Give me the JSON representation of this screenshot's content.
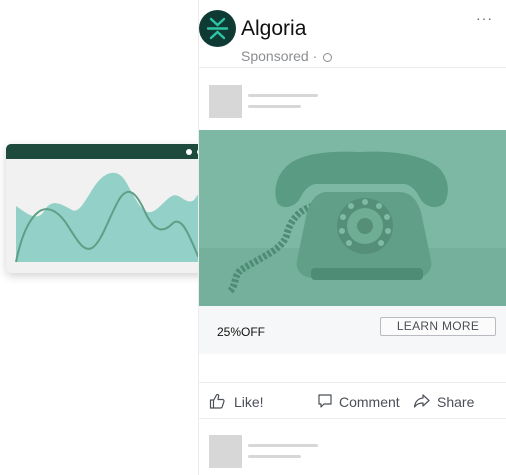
{
  "ad": {
    "brand_name": "Algoria",
    "sponsored_text": "Sponsored ·",
    "more_icon": "···",
    "offer_text": "25%OFF",
    "cta_label": "LEARN MORE"
  },
  "actions": {
    "like": "Like!",
    "comment": "Comment",
    "share": "Share"
  },
  "icons": {
    "logo": "algoria-logo-icon",
    "globe": "globe-icon",
    "more": "more-options-icon",
    "like": "thumbs-up-icon",
    "comment": "comment-icon",
    "share": "share-arrow-icon",
    "window_controls": "window-dots-icon"
  },
  "colors": {
    "brand_dark": "#0f3a33",
    "brand_accent": "#2fc4a6",
    "hero_green": "#7db8a4",
    "chart_fill": "#93d0c8",
    "chart_line": "#5e9f86",
    "window_bar": "#1e4a3e"
  }
}
